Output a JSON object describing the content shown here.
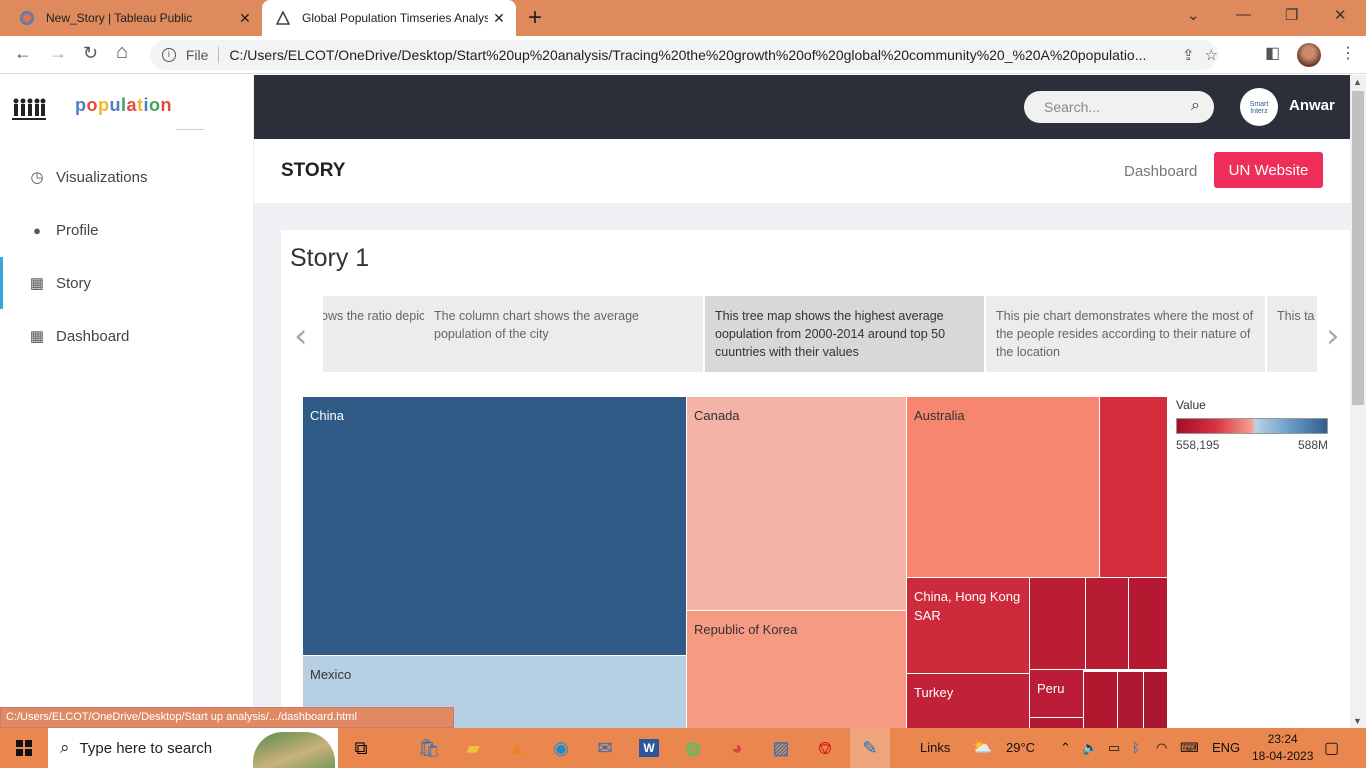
{
  "browser": {
    "tabs": [
      {
        "title": "New_Story | Tableau Public",
        "close": "✕"
      },
      {
        "title": "Global Population Timseries Analysis",
        "close": "✕"
      }
    ],
    "new_tab": "+",
    "window_controls": {
      "dropdown": "⌄",
      "minimize": "—",
      "restore": "❐",
      "close": "✕"
    },
    "back": "←",
    "forward": "→",
    "reload": "↻",
    "home": "⌂",
    "address": {
      "info": "i",
      "scheme": "File",
      "url": "C:/Users/ELCOT/OneDrive/Desktop/Start%20up%20analysis/Tracing%20the%20growth%20of%20global%20community%20_%20A%20populatio..."
    },
    "status_url": "C:/Users/ELCOT/OneDrive/Desktop/Start up analysis/.../dashboard.html"
  },
  "sidebar": {
    "logo_text": "population",
    "items": [
      {
        "label": "Visualizations",
        "icon": "clock-icon",
        "glyph": "◷"
      },
      {
        "label": "Profile",
        "icon": "user-icon",
        "glyph": "👤"
      },
      {
        "label": "Story",
        "icon": "table-icon",
        "glyph": "▦",
        "active": true
      },
      {
        "label": "Dashboard",
        "icon": "table-icon",
        "glyph": "▦"
      }
    ]
  },
  "header": {
    "search_placeholder": "Search...",
    "avatar_text": "Smart Interz",
    "user_name": "Anwar"
  },
  "storybar": {
    "title": "STORY",
    "dashboard_link": "Dashboard",
    "un_button": "UN Website"
  },
  "story": {
    "title": "Story 1",
    "prev_arrow": "‹",
    "next_arrow": "›",
    "points": [
      "ows the ratio depicts the value",
      "The column chart shows the average population of the city",
      "This tree map shows the highest average oopulation from 2000-2014 around top 50 cuuntries with their values",
      "This pie chart demonstrates where the most of the people resides according to their nature of the location",
      "This ta about s data"
    ],
    "selected_point": 2
  },
  "chart_data": {
    "type": "heatmap",
    "subtype": "treemap",
    "legend_title": "Value",
    "color_range": {
      "min_label": "558,195",
      "max_label": "588M",
      "low_color": "#a50f2a",
      "high_color": "#2f5e8c"
    },
    "labeled_cells": [
      "China",
      "Canada",
      "Australia",
      "Mexico",
      "Republic of Korea",
      "China, Hong Kong SAR",
      "Turkey",
      "Peru"
    ]
  },
  "taskbar": {
    "search_placeholder": "Type here to search",
    "links": "Links",
    "weather": "29°C",
    "lang": "ENG",
    "time": "23:24",
    "date": "18-04-2023"
  }
}
